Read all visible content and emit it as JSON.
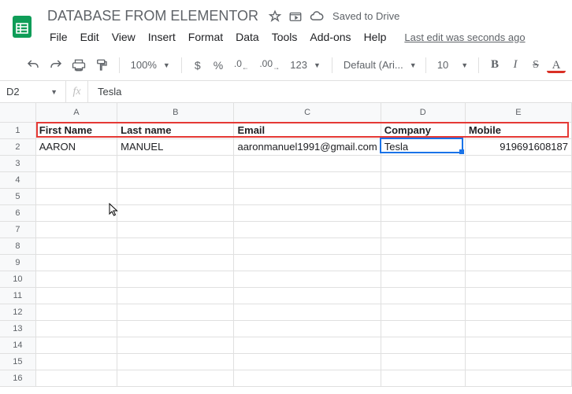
{
  "header": {
    "title": "DATABASE FROM ELEMENTOR",
    "saved_label": "Saved to Drive"
  },
  "menu": {
    "items": [
      "File",
      "Edit",
      "View",
      "Insert",
      "Format",
      "Data",
      "Tools",
      "Add-ons",
      "Help"
    ],
    "last_edit": "Last edit was seconds ago"
  },
  "toolbar": {
    "zoom": "100%",
    "currency": "$",
    "percent": "%",
    "dec_dec": ".0",
    "inc_dec": ".00",
    "more_formats": "123",
    "font_name": "Default (Ari...",
    "font_size": "10",
    "bold": "B",
    "italic": "I",
    "strike": "S",
    "textcolor": "A"
  },
  "namebox": {
    "cell_ref": "D2",
    "fx_label": "fx",
    "formula_value": "Tesla"
  },
  "grid": {
    "col_headers": [
      "A",
      "B",
      "C",
      "D",
      "E"
    ],
    "row_count": 16,
    "headers": {
      "A": "First Name",
      "B": "Last name",
      "C": "Email",
      "D": "Company",
      "E": "Mobile"
    },
    "data_row": {
      "A": "AARON",
      "B": "MANUEL",
      "C": "aaronmanuel1991@gmail.com",
      "D": "Tesla",
      "E": "919691608187"
    },
    "active_cell": "D2"
  },
  "chart_data": {
    "type": "table",
    "title": "DATABASE FROM ELEMENTOR",
    "columns": [
      "First Name",
      "Last name",
      "Email",
      "Company",
      "Mobile"
    ],
    "rows": [
      [
        "AARON",
        "MANUEL",
        "aaronmanuel1991@gmail.com",
        "Tesla",
        "919691608187"
      ]
    ]
  }
}
